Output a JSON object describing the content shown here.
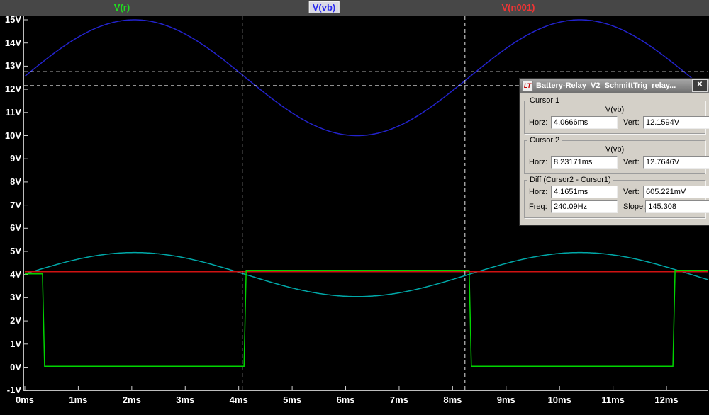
{
  "legend": {
    "items": [
      {
        "id": "v-r",
        "label": "V(r)",
        "color": "#1ee11e",
        "x_pct": 17.2,
        "selected": false
      },
      {
        "id": "v-vb",
        "label": "V(vb)",
        "color": "#2a2aee",
        "x_pct": 45.7,
        "selected": true
      },
      {
        "id": "v-n001",
        "label": "V(n001)",
        "color": "#f23434",
        "x_pct": 73.1,
        "selected": false
      }
    ]
  },
  "axes": {
    "y": {
      "ticks": [
        {
          "v": 15,
          "label": "15V"
        },
        {
          "v": 14,
          "label": "14V"
        },
        {
          "v": 13,
          "label": "13V"
        },
        {
          "v": 12,
          "label": "12V"
        },
        {
          "v": 11,
          "label": "11V"
        },
        {
          "v": 10,
          "label": "10V"
        },
        {
          "v": 9,
          "label": "9V"
        },
        {
          "v": 8,
          "label": "8V"
        },
        {
          "v": 7,
          "label": "7V"
        },
        {
          "v": 6,
          "label": "6V"
        },
        {
          "v": 5,
          "label": "5V"
        },
        {
          "v": 4,
          "label": "4V"
        },
        {
          "v": 3,
          "label": "3V"
        },
        {
          "v": 2,
          "label": "2V"
        },
        {
          "v": 1,
          "label": "1V"
        },
        {
          "v": 0,
          "label": "0V"
        },
        {
          "v": -1,
          "label": "-1V"
        }
      ]
    },
    "x": {
      "ticks": [
        {
          "t": 0,
          "label": "0ms"
        },
        {
          "t": 1,
          "label": "1ms"
        },
        {
          "t": 2,
          "label": "2ms"
        },
        {
          "t": 3,
          "label": "3ms"
        },
        {
          "t": 4,
          "label": "4ms"
        },
        {
          "t": 5,
          "label": "5ms"
        },
        {
          "t": 6,
          "label": "6ms"
        },
        {
          "t": 7,
          "label": "7ms"
        },
        {
          "t": 8,
          "label": "8ms"
        },
        {
          "t": 9,
          "label": "9ms"
        },
        {
          "t": 10,
          "label": "10ms"
        },
        {
          "t": 11,
          "label": "11ms"
        },
        {
          "t": 12,
          "label": "12ms"
        }
      ]
    }
  },
  "chart_data": {
    "type": "line",
    "title": "",
    "x_range_ms": [
      0,
      12.78
    ],
    "y_range_v": [
      -1,
      15
    ],
    "x_ticks_ms": [
      0,
      1,
      2,
      3,
      4,
      5,
      6,
      7,
      8,
      9,
      10,
      11,
      12
    ],
    "y_ticks_v": [
      15,
      14,
      13,
      12,
      11,
      10,
      9,
      8,
      7,
      6,
      5,
      4,
      3,
      2,
      1,
      0,
      -1
    ],
    "grid": false,
    "series": [
      {
        "name": "V(vb)",
        "color": "#2323cd",
        "kind": "sine",
        "center_v": 12.5,
        "amplitude_v": 2.5,
        "period_ms": 8.3302,
        "peak_at_ms": 2.05
      },
      {
        "name": "",
        "color": "#00a8a8",
        "kind": "sine",
        "center_v": 4.0,
        "amplitude_v": 0.95,
        "period_ms": 8.3302,
        "peak_at_ms": 2.05
      },
      {
        "name": "V(n001)",
        "color": "#cf1212",
        "kind": "flat",
        "value_v": 4.12
      },
      {
        "name": "V(r)",
        "color": "#00d400",
        "kind": "piecewise",
        "points_ms_v": [
          [
            0,
            4.03
          ],
          [
            0.33,
            4.03
          ],
          [
            0.37,
            0.04
          ],
          [
            4.1,
            0.04
          ],
          [
            4.14,
            4.18
          ],
          [
            8.31,
            4.18
          ],
          [
            8.35,
            0.04
          ],
          [
            12.12,
            0.04
          ],
          [
            12.16,
            4.18
          ],
          [
            12.78,
            4.18
          ]
        ]
      }
    ],
    "cursors": [
      {
        "name": "cursor1",
        "t_ms": 4.0666,
        "v": 12.1594
      },
      {
        "name": "cursor2",
        "t_ms": 8.23171,
        "v": 12.7646
      }
    ]
  },
  "dialog": {
    "icon_text": "LT",
    "title": "Battery-Relay_V2_SchmittTrig_relay...",
    "close_glyph": "✕",
    "labels": {
      "horz": "Horz:",
      "vert": "Vert:",
      "freq": "Freq:",
      "slope": "Slope:"
    },
    "cursor1": {
      "heading": "Cursor 1",
      "signal": "V(vb)",
      "horz": "4.0666ms",
      "vert": "12.1594V"
    },
    "cursor2": {
      "heading": "Cursor 2",
      "signal": "V(vb)",
      "horz": "8.23171ms",
      "vert": "12.7646V"
    },
    "diff": {
      "heading": "Diff (Cursor2 - Cursor1)",
      "horz": "4.1651ms",
      "vert": "605.221mV",
      "freq": "240.09Hz",
      "slope": "145.308"
    }
  }
}
